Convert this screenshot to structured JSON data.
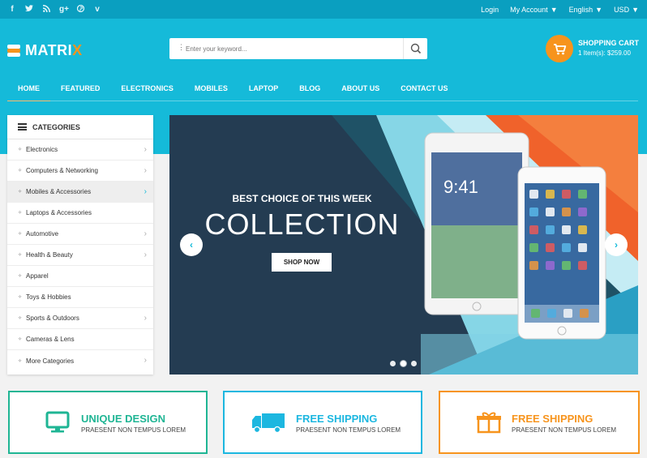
{
  "colors": {
    "topbar": "#0a9fc0",
    "header": "#15bad9",
    "accent": "#f7941d",
    "slide_bg": "#243c52",
    "feature_green": "#1fb594",
    "feature_blue": "#1cb7e0",
    "feature_orange": "#f7941d"
  },
  "topbar": {
    "social_icons": [
      "facebook-icon",
      "twitter-icon",
      "rss-icon",
      "google-plus-icon",
      "pinterest-icon",
      "vimeo-icon"
    ],
    "login": "Login",
    "my_account": "My Account",
    "language": "English",
    "currency": "USD"
  },
  "logo": {
    "main": "MATRI",
    "accent": "X"
  },
  "search": {
    "placeholder": "Enter your keyword..."
  },
  "cart": {
    "title": "SHOPPING CART",
    "summary": "1 Item(s): $259.00"
  },
  "nav": [
    "Home",
    "Featured",
    "Electronics",
    "Mobiles",
    "Laptop",
    "Blog",
    "About us",
    "Contact us"
  ],
  "categories": {
    "title": "Categories",
    "items": [
      {
        "label": "Electronics",
        "has_sub": true
      },
      {
        "label": "Computers & Networking",
        "has_sub": true
      },
      {
        "label": "Mobiles & Accessories",
        "has_sub": true,
        "active": true
      },
      {
        "label": "Laptops & Accessories",
        "has_sub": false
      },
      {
        "label": "Automotive",
        "has_sub": true
      },
      {
        "label": "Health & Beauty",
        "has_sub": true
      },
      {
        "label": "Apparel",
        "has_sub": false
      },
      {
        "label": "Toys & Hobbies",
        "has_sub": false
      },
      {
        "label": "Sports & Outdoors",
        "has_sub": true
      },
      {
        "label": "Cameras & Lens",
        "has_sub": false
      },
      {
        "label": "More Categories",
        "has_sub": true
      }
    ]
  },
  "slider": {
    "headline": "BEST CHOICE OF THIS WEEK",
    "title": "COLLECTION",
    "button": "SHOP NOW",
    "tablet_time": "9:41",
    "slide_count": 3,
    "active_slide": 2
  },
  "features": [
    {
      "icon": "monitor-icon",
      "title": "UNIQUE DESIGN",
      "subtitle": "PRAESENT NON TEMPUS LOREM",
      "color": "#1fb594"
    },
    {
      "icon": "delivery-truck-icon",
      "title": "FREE SHIPPING",
      "subtitle": "PRAESENT NON TEMPUS LOREM",
      "color": "#1cb7e0"
    },
    {
      "icon": "gift-icon",
      "title": "FREE SHIPPING",
      "subtitle": "PRAESENT NON TEMPUS LOREM",
      "color": "#f7941d"
    }
  ]
}
